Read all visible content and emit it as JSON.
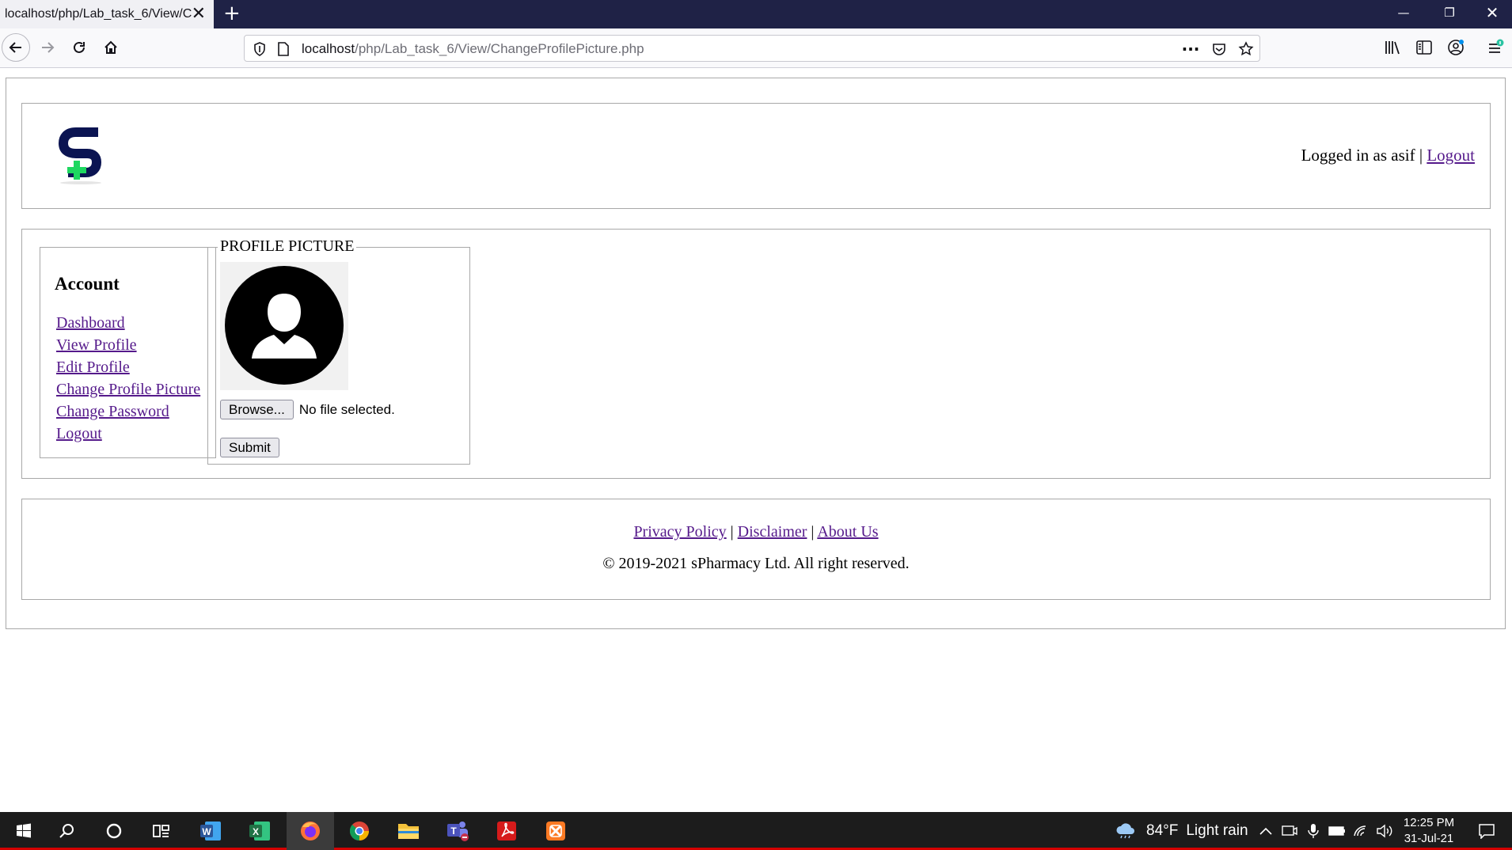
{
  "browser": {
    "tab_title": "localhost/php/Lab_task_6/View/Cha",
    "url_host": "localhost",
    "url_path": "/php/Lab_task_6/View/ChangeProfilePicture.php",
    "new_tab_icon": "plus-icon",
    "window_controls": [
      "minimize-icon",
      "restore-icon",
      "close-icon"
    ],
    "nav_icons": [
      "back-arrow-icon",
      "forward-arrow-icon",
      "reload-icon",
      "home-icon"
    ],
    "toolbar_icons": [
      "library-icon",
      "sidebar-icon",
      "account-icon",
      "menu-icon"
    ]
  },
  "header": {
    "logo_icon": "spharmacy-logo",
    "logged_in_text": "Logged in as asif | ",
    "logout_label": "Logout"
  },
  "sidebar": {
    "heading": "Account",
    "items": [
      {
        "label": "Dashboard"
      },
      {
        "label": "View Profile"
      },
      {
        "label": "Edit Profile"
      },
      {
        "label": "Change Profile Picture"
      },
      {
        "label": "Change Password"
      },
      {
        "label": "Logout"
      }
    ]
  },
  "profile_picture": {
    "legend": "PROFILE PICTURE",
    "avatar_icon": "user-avatar-icon",
    "browse_label": "Browse...",
    "no_file_text": "No file selected.",
    "submit_label": "Submit"
  },
  "footer": {
    "links": [
      {
        "label": "Privacy Policy"
      },
      {
        "label": "Disclaimer"
      },
      {
        "label": "About Us"
      }
    ],
    "separator": " | ",
    "copyright": "© 2019-2021 sPharmacy Ltd. All right reserved."
  },
  "taskbar": {
    "apps": [
      "windows-start-icon",
      "search-icon",
      "cortana-icon",
      "task-view-icon",
      "word-icon",
      "excel-icon",
      "firefox-icon",
      "chrome-icon",
      "file-explorer-icon",
      "teams-icon",
      "acrobat-icon",
      "xampp-icon"
    ],
    "weather_temp": "84°F",
    "weather_desc": "Light rain",
    "time": "12:25 PM",
    "date": "31-Jul-21",
    "colors": {
      "word": "#2b579a",
      "excel": "#217346",
      "acrobat": "#d61b1b",
      "xampp": "#fb7a24",
      "accent": "#d40000"
    }
  }
}
